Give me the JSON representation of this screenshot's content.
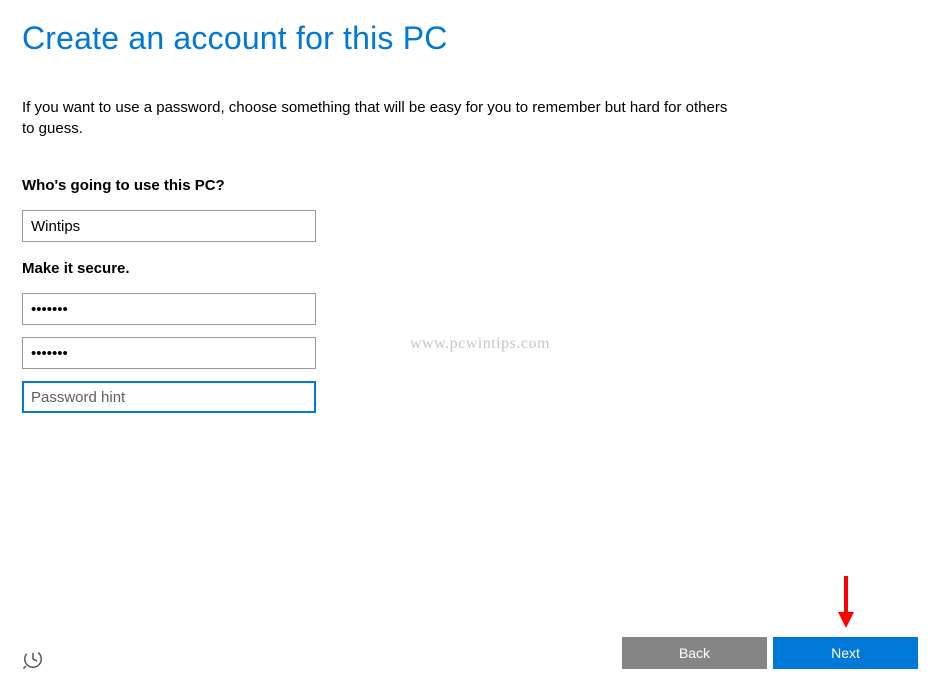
{
  "header": {
    "title": "Create an account for this PC"
  },
  "description": "If you want to use a password, choose something that will be easy for you to remember but hard for others to guess.",
  "user_section": {
    "label": "Who's going to use this PC?",
    "username_value": "Wintips"
  },
  "secure_section": {
    "label": "Make it secure.",
    "password_value": "•••••••",
    "confirm_value": "•••••••",
    "hint_placeholder": "Password hint"
  },
  "watermark": "www.pcwintips.com",
  "footer": {
    "back_label": "Back",
    "next_label": "Next"
  }
}
